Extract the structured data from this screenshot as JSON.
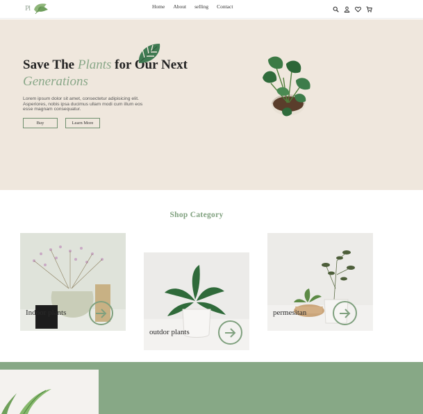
{
  "nav": {
    "logo_text": "Pl",
    "links": [
      "Home",
      "About",
      "selling",
      "Contact"
    ],
    "icons": [
      "search-icon",
      "user-icon",
      "heart-icon",
      "cart-icon"
    ]
  },
  "hero": {
    "title_part1": "Save The ",
    "title_accent1": "Plants",
    "title_part2": " for Our Next ",
    "title_accent2": "Generations",
    "description": "Lorem ipsum dolor sit amet, consectetur adipisicing elit. Asperiores, nobis ipsa ducimus ullam modi cum illum eos esse magnam consequatur.",
    "buy_label": "Buy",
    "learn_label": "Learn More"
  },
  "category": {
    "title": "Shop Category",
    "cards": [
      {
        "label": "Indoor plants"
      },
      {
        "label": "outdor plants"
      },
      {
        "label": "permesitan"
      }
    ]
  },
  "colors": {
    "accent": "#87a886",
    "hero_bg": "#efe7dd"
  }
}
